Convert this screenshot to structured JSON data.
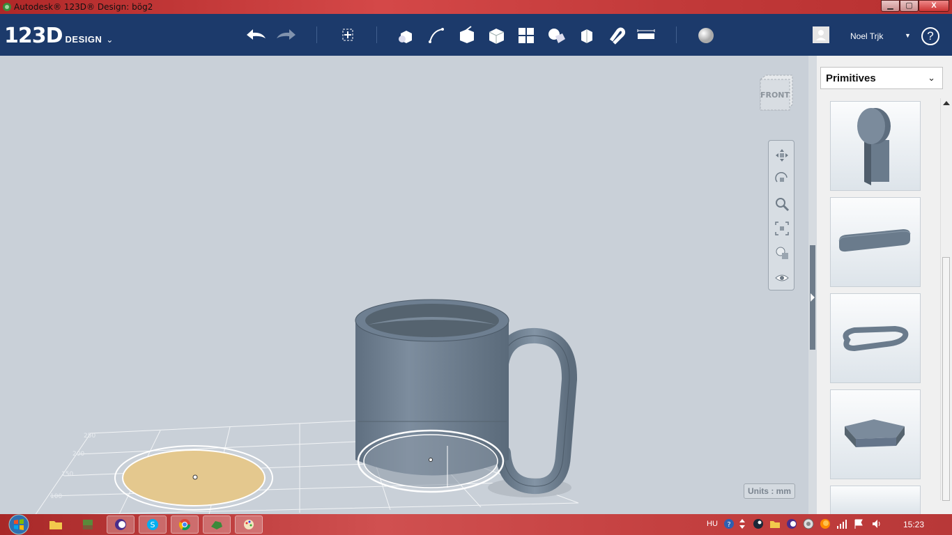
{
  "window": {
    "title": "Autodesk® 123D® Design: bög2",
    "controls": {
      "minimize": "▁",
      "maximize": "▢",
      "close": "X"
    }
  },
  "toolbar": {
    "logo_main": "123D",
    "logo_sub": "DESIGN",
    "logo_chevron": "⌄",
    "user_name": "Noel Trjk",
    "user_dropdown": "▼",
    "help": "?"
  },
  "viewcube": {
    "face_label": "FRONT"
  },
  "grid": {
    "labels": [
      "250",
      "200",
      "150",
      "100"
    ]
  },
  "units": {
    "label": "Units : mm"
  },
  "panel": {
    "dropdown_label": "Primitives",
    "dropdown_chevron": "⌄"
  },
  "taskbar": {
    "language": "HU",
    "clock": "15:23"
  },
  "colors": {
    "toolbar": "#1c3a6b",
    "viewport": "#c9d0d8",
    "model": "#6c7d8f",
    "sketch": "#e4c88e"
  }
}
